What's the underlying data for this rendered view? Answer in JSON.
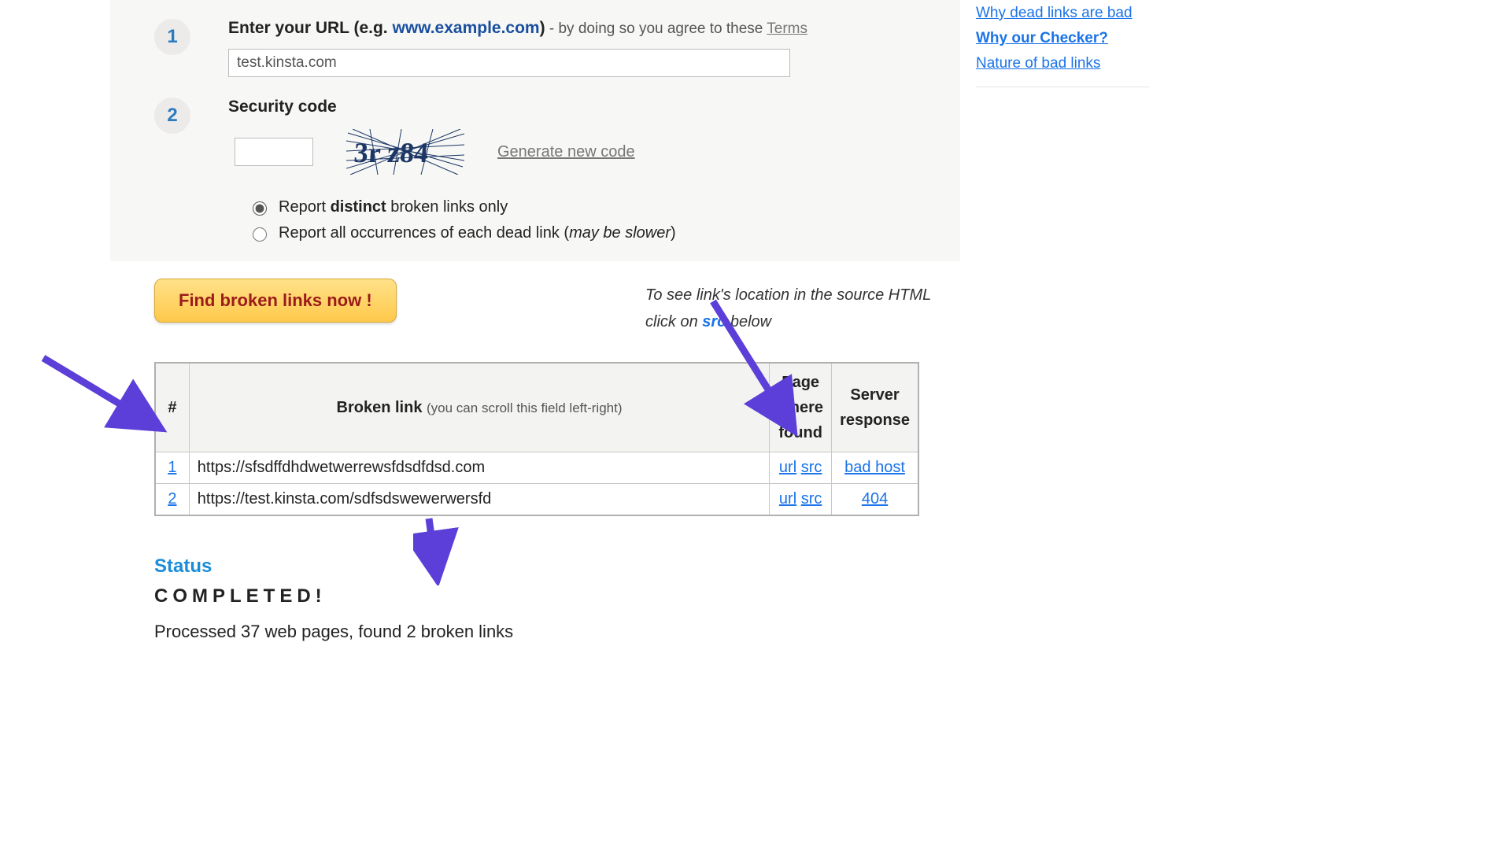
{
  "step1": {
    "badge": "1",
    "label_prefix": "Enter your URL (e.g. ",
    "label_example": "www.example.com",
    "label_suffix": ")",
    "agree_text": " - by doing so you agree to these ",
    "terms_label": "Terms",
    "url_value": "test.kinsta.com"
  },
  "step2": {
    "badge": "2",
    "label": "Security code",
    "captcha_text": "3r z84",
    "generate_label": "Generate new code",
    "radios": {
      "distinct_pre": "Report ",
      "distinct_bold": "distinct",
      "distinct_post": " broken links only",
      "all_pre": "Report all occurrences of each dead link (",
      "all_italic": "may be slower",
      "all_post": ")"
    }
  },
  "action": {
    "button_label": "Find broken links now !",
    "hint_line1": "To see link's location in the source HTML",
    "hint_line2_pre": "click on ",
    "hint_src": "src",
    "hint_line2_post": " below"
  },
  "table": {
    "headers": {
      "num": "#",
      "link": "Broken link",
      "link_sub": "(you can scroll this field left-right)",
      "page": "Page where found",
      "resp": "Server response"
    },
    "rows": [
      {
        "num": "1",
        "url": "https://sfsdffdhdwetwerrewsfdsdfdsd.com",
        "page_url": "url",
        "page_src": "src",
        "resp": "bad host"
      },
      {
        "num": "2",
        "url": "https://test.kinsta.com/sdfsdswewerwersfd",
        "page_url": "url",
        "page_src": "src",
        "resp": "404"
      }
    ]
  },
  "status": {
    "heading": "Status",
    "completed": "COMPLETED!",
    "summary": "Processed 37 web pages, found 2 broken links"
  },
  "sidebar": {
    "links": [
      {
        "label": "Why dead links are bad",
        "active": false
      },
      {
        "label": "Why our Checker?",
        "active": true
      },
      {
        "label": "Nature of bad links",
        "active": false
      }
    ]
  }
}
